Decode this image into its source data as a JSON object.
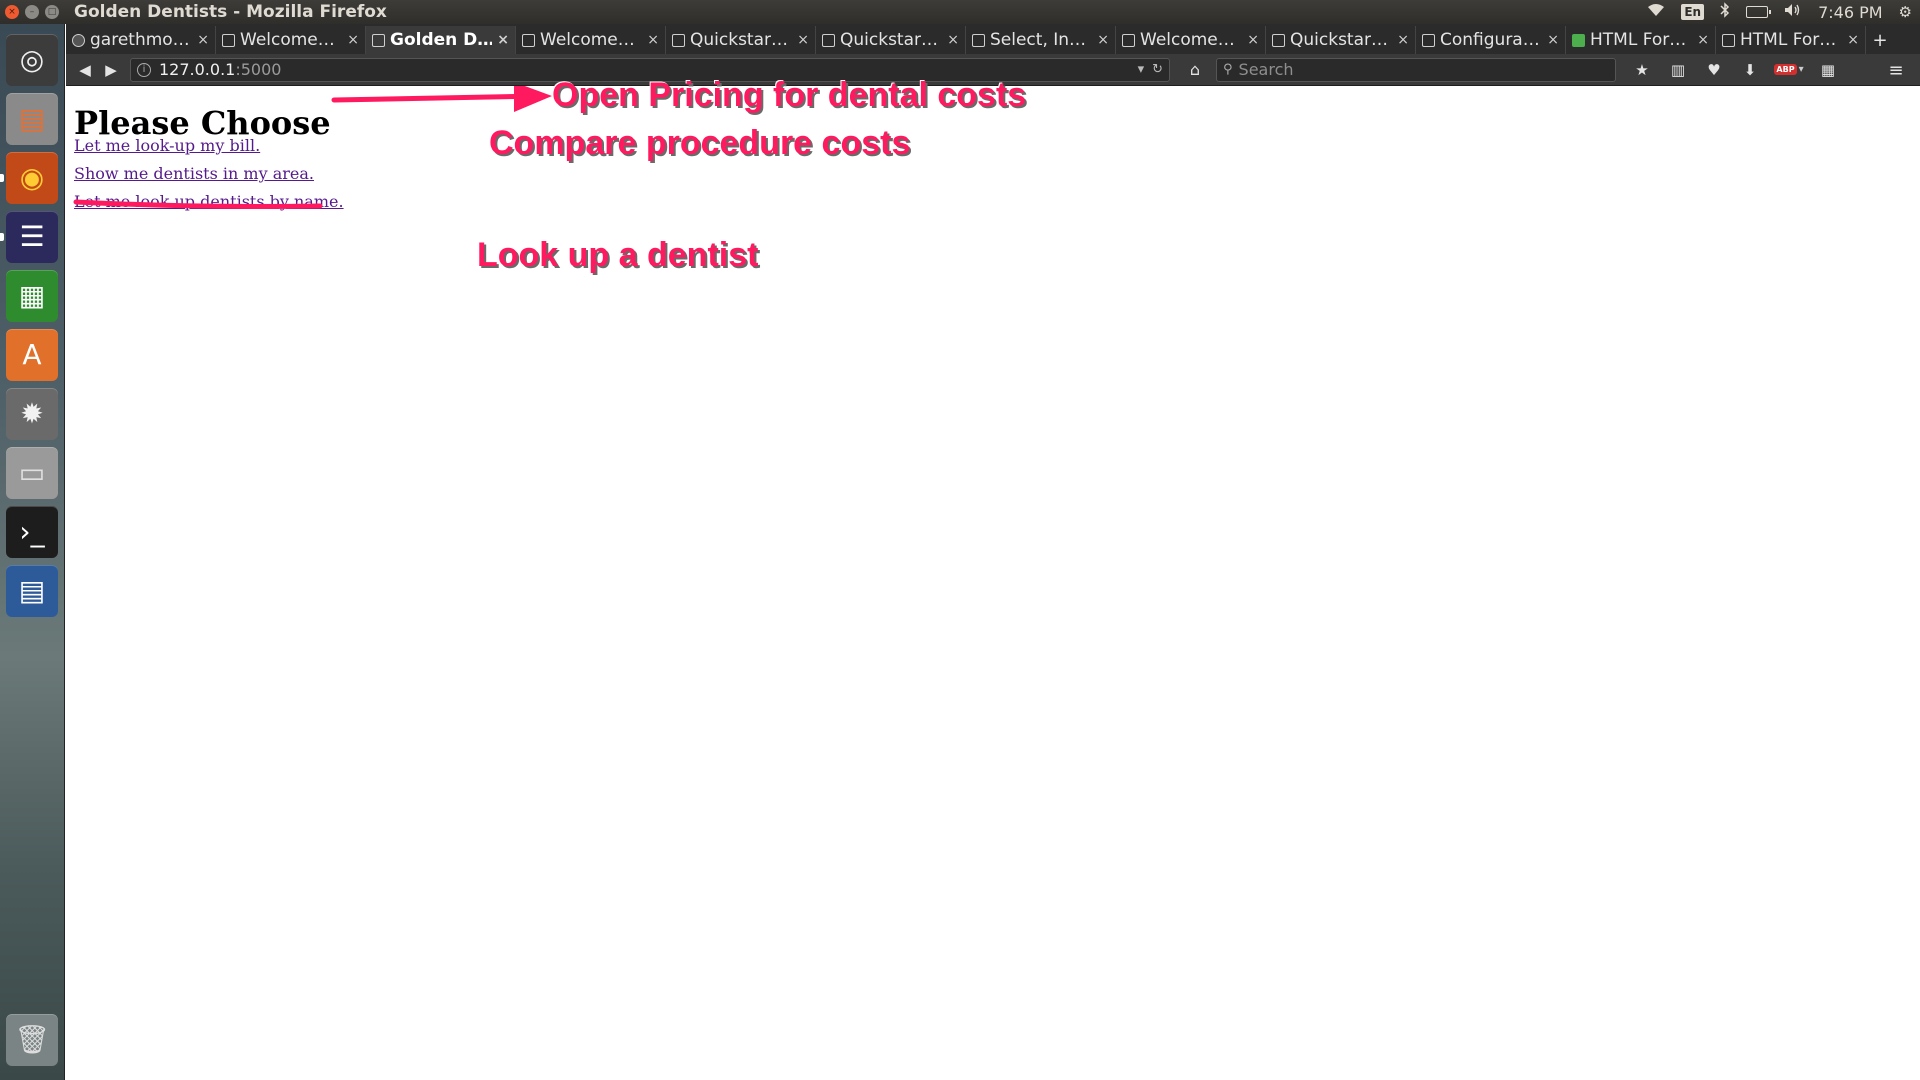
{
  "window": {
    "title": "Golden Dentists - Mozilla Firefox",
    "close_glyph": "×",
    "min_glyph": "–",
    "max_glyph": "□"
  },
  "tray": {
    "wifi_icon": "wifi-icon",
    "keyboard_layout": "En",
    "bluetooth_icon": "bluetooth-icon",
    "battery_icon": "battery-icon",
    "volume_icon": "volume-icon",
    "time": "7:46 PM",
    "gear_icon": "gear-icon"
  },
  "launcher": {
    "items": [
      {
        "name": "dash-home",
        "glyph": "◎",
        "bg": "#3c3c3c",
        "fg": "#f0f0f0"
      },
      {
        "name": "files-app",
        "glyph": "▤",
        "bg": "#8a8a8a",
        "fg": "#e86f2f"
      },
      {
        "name": "firefox-app",
        "glyph": "◉",
        "bg": "#c24a18",
        "fg": "#ffcc33"
      },
      {
        "name": "eclipse-app",
        "glyph": "☰",
        "bg": "#2c2a5c",
        "fg": "#ffffff"
      },
      {
        "name": "calc-spreadsheet-app",
        "glyph": "▦",
        "bg": "#2e8b2e",
        "fg": "#ffffff"
      },
      {
        "name": "software-center-app",
        "glyph": "A",
        "bg": "#e0702a",
        "fg": "#ffffff"
      },
      {
        "name": "system-settings-app",
        "glyph": "✹",
        "bg": "#6a6a6a",
        "fg": "#f2f2f2"
      },
      {
        "name": "disk-drive-app",
        "glyph": "▭",
        "bg": "#9a9a9a",
        "fg": "#e0e0e0"
      },
      {
        "name": "terminal-app",
        "glyph": "›_",
        "bg": "#1d1d1d",
        "fg": "#ffffff"
      },
      {
        "name": "writer-document-app",
        "glyph": "▤",
        "bg": "#2d5b9a",
        "fg": "#ffffff"
      }
    ],
    "trash": {
      "name": "trash-app",
      "glyph": "🗑",
      "bg": "#7a8484",
      "fg": "#dddddd"
    }
  },
  "tabs": [
    {
      "label": "garethmo…",
      "favicon": "dark",
      "active": false
    },
    {
      "label": "Welcome…",
      "favicon": "plain",
      "active": false
    },
    {
      "label": "Golden D…",
      "favicon": "plain",
      "active": true
    },
    {
      "label": "Welcome…",
      "favicon": "plain",
      "active": false
    },
    {
      "label": "Quickstar…",
      "favicon": "plain",
      "active": false
    },
    {
      "label": "Quickstar…",
      "favicon": "plain",
      "active": false
    },
    {
      "label": "Select, In…",
      "favicon": "plain",
      "active": false
    },
    {
      "label": "Welcome…",
      "favicon": "plain",
      "active": false
    },
    {
      "label": "Quickstar…",
      "favicon": "plain",
      "active": false
    },
    {
      "label": "Configura…",
      "favicon": "plain",
      "active": false
    },
    {
      "label": "HTML For…",
      "favicon": "green",
      "active": false
    },
    {
      "label": "HTML For…",
      "favicon": "plain",
      "active": false
    }
  ],
  "tab_close_glyph": "×",
  "new_tab_glyph": "+",
  "navbar": {
    "back_glyph": "◀",
    "forward_glyph": "▶",
    "info_glyph": "i",
    "url_host": "127.0.0.1",
    "url_port": ":5000",
    "dropdown_glyph": "▾",
    "reload_glyph": "↻",
    "home_glyph": "⌂",
    "search_glyph": "⚲",
    "search_placeholder": "Search",
    "bookmark_glyph": "★",
    "reading_list_glyph": "▥",
    "pocket_glyph": "♥",
    "download_glyph": "⬇",
    "abp_badge": "ABP",
    "abp_dropdown": "▾",
    "extension_glyph": "▦",
    "menu_glyph": "≡"
  },
  "page": {
    "heading": "Please Choose",
    "links": [
      "Let me look-up my bill.",
      "Show me dentists in my area.",
      "Let me look up dentists by name."
    ]
  },
  "annotations": {
    "open_pricing": "Open Pricing for dental costs",
    "compare_costs": "Compare procedure costs",
    "look_up_dentist": "Look up a dentist",
    "color": "#ff1a60"
  }
}
